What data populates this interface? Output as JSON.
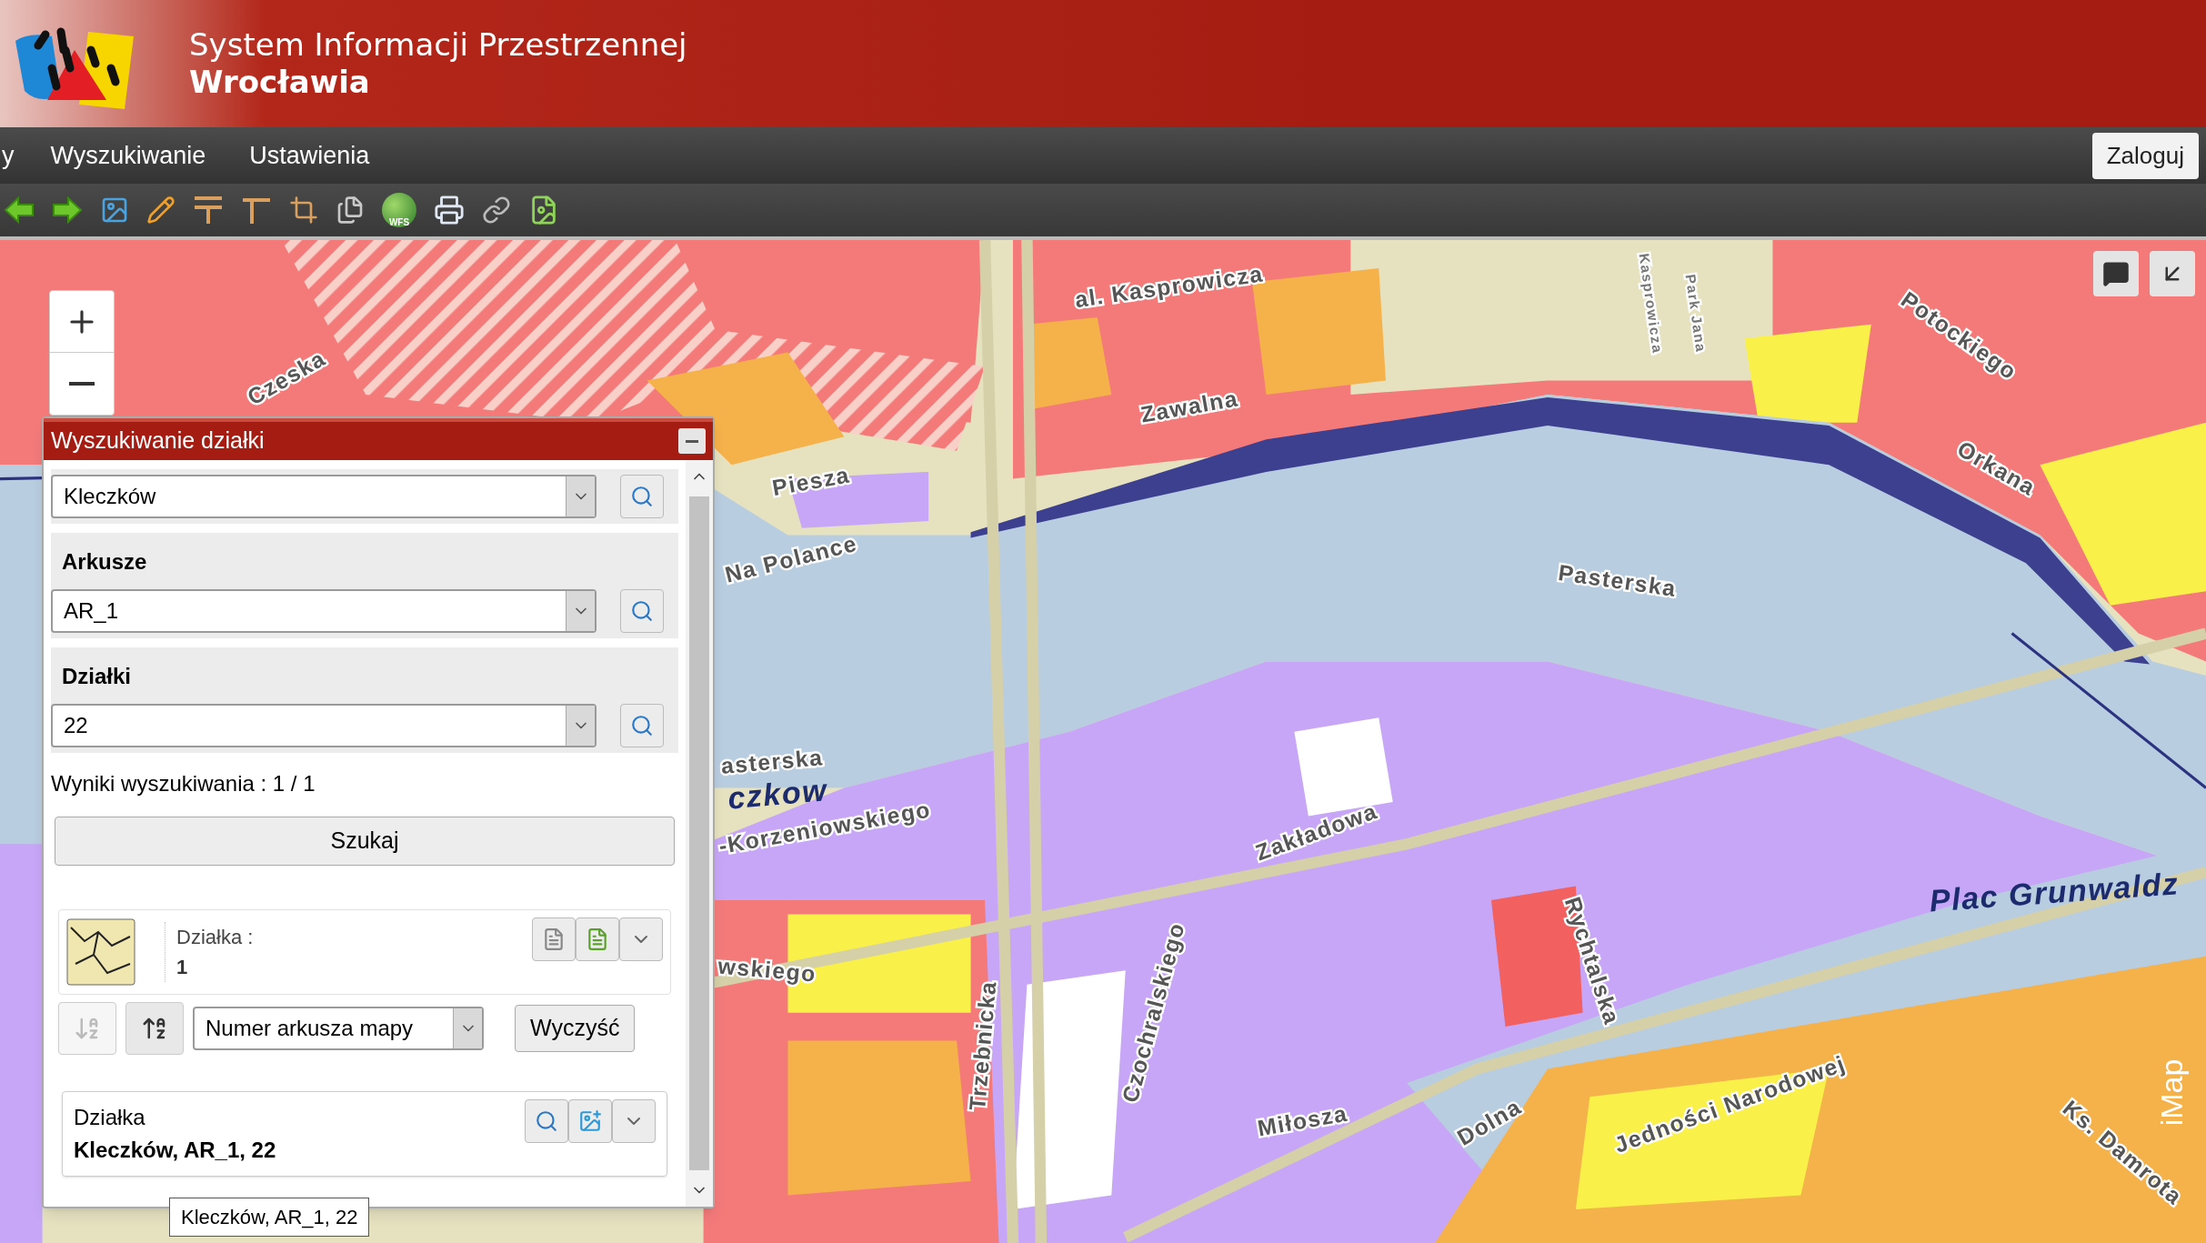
{
  "header": {
    "title": "System Informacji Przestrzennej",
    "subtitle": "Wrocławia"
  },
  "menu": {
    "items": [
      "y",
      "Wyszukiwanie",
      "Ustawienia"
    ],
    "login_button": "Zaloguj"
  },
  "toolbar": {
    "wfs_label": "WFS"
  },
  "map": {
    "labels": [
      {
        "text": "al. Kasprowicza"
      },
      {
        "text": "Zawalna"
      },
      {
        "text": "Pasterska"
      },
      {
        "text": "Piesza"
      },
      {
        "text": "Na Polance"
      },
      {
        "text": "Zakładowa"
      },
      {
        "text": "Plac Grunwaldz"
      },
      {
        "text": "Rychtalska"
      },
      {
        "text": "Czochralskiego"
      },
      {
        "text": "Trzebnicka"
      },
      {
        "text": "Miłosza"
      },
      {
        "text": "Dolna"
      },
      {
        "text": "Jedności Narodowej"
      },
      {
        "text": "Potockiego"
      },
      {
        "text": "Orkana"
      },
      {
        "text": "Czeska"
      },
      {
        "text": "czkow"
      },
      {
        "text": "-Korzeniowskiego"
      },
      {
        "text": "asterska"
      },
      {
        "text": "wskiego"
      },
      {
        "text": "Ks. Damrota"
      },
      {
        "text": "Kasprowicza"
      },
      {
        "text": "Park Jana"
      }
    ],
    "attribution": "iMap"
  },
  "panel": {
    "title": "Wyszukiwanie działki",
    "sections": [
      {
        "value": "Kleczków"
      },
      {
        "label": "Arkusze",
        "value": "AR_1"
      },
      {
        "label": "Działki",
        "value": "22"
      }
    ],
    "results_text": "Wyniki wyszukiwania : 1 / 1",
    "search_button": "Szukaj",
    "result_card": {
      "label": "Działka :",
      "value": "1"
    },
    "sort_buttons": [
      {
        "disabled": true
      },
      {
        "disabled": false
      }
    ],
    "sort_select": "Numer arkusza mapy",
    "clear_button": "Wyczyść",
    "selected": {
      "label": "Działka",
      "value": "Kleczków, AR_1, 22"
    },
    "tooltip": "Kleczków, AR_1, 22"
  }
}
